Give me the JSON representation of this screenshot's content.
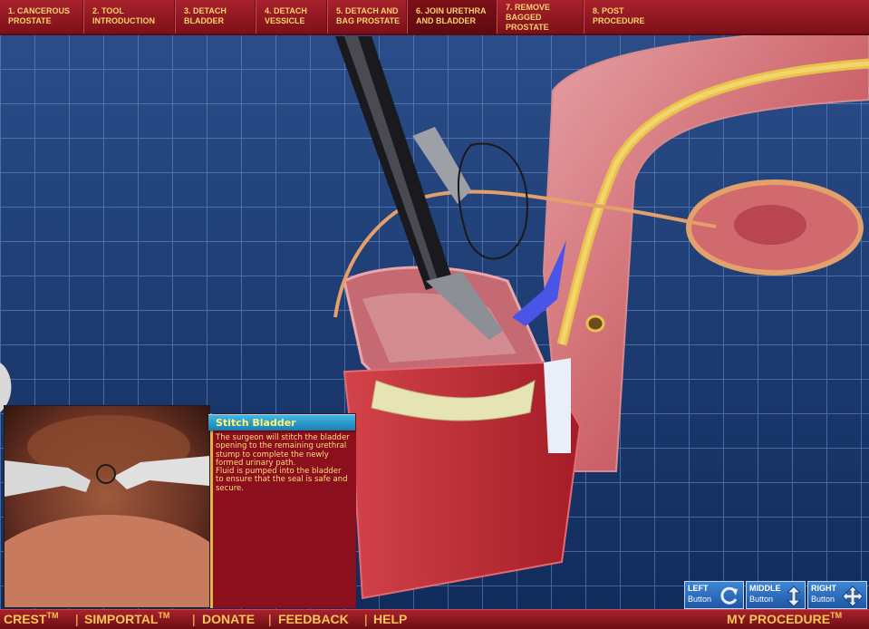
{
  "nav": {
    "tabs": [
      {
        "label": "1. Cancerous Prostate"
      },
      {
        "label": "2. Tool Introduction"
      },
      {
        "label": "3. Detach Bladder"
      },
      {
        "label": "4. Detach Vessicle"
      },
      {
        "label": "5. Detach and Bag Prostate"
      },
      {
        "label": "6. Join Urethra and Bladder"
      },
      {
        "label": "7. Remove Bagged Prostate"
      },
      {
        "label": "8. Post Procedure"
      }
    ],
    "active_tab": "6. Join Urethra and Bladder"
  },
  "info": {
    "title": "Stitch Bladder",
    "text": "The surgeon will stitch the bladder opening to the remaining urethral stump to complete the newly formed urinary path.\nFluid is pumped into the bladder to ensure that the seal is safe and secure."
  },
  "mouse_legend": {
    "left": {
      "label": "LEFT",
      "sub": "Button",
      "icon": "rotate-icon"
    },
    "middle": {
      "label": "MIDDLE",
      "sub": "Button",
      "icon": "zoom-arrows-icon"
    },
    "right": {
      "label": "RIGHT",
      "sub": "Button",
      "icon": "pan-arrows-icon"
    }
  },
  "footer": {
    "crest": "CREST",
    "simportal": "SIMPORTAL",
    "tm": "TM",
    "donate": "DONATE",
    "feedback": "FEEDBACK",
    "help": "HELP",
    "separator": "|",
    "my_procedure": "MY PROCEDURE"
  },
  "colors": {
    "nav_bg": "#9b1a24",
    "nav_text": "#f6d36a",
    "grid_bg": "#1b3f7c",
    "panel_bg": "#8b0f1c",
    "panel_title_bg": "#2a9fd0",
    "panel_text": "#ffdf7a"
  }
}
